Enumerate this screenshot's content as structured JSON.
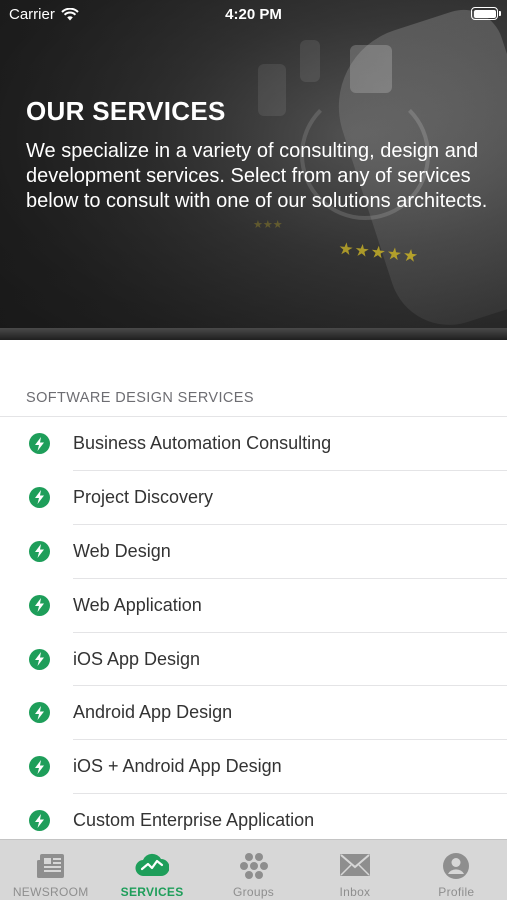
{
  "status_bar": {
    "carrier": "Carrier",
    "time": "4:20 PM"
  },
  "hero": {
    "title": "OUR SERVICES",
    "description": "We specialize in a variety of consulting, design and development services. Select from any of services below to consult with one of our solutions architects."
  },
  "section": {
    "header": "SOFTWARE DESIGN SERVICES",
    "items": [
      {
        "label": "Business Automation Consulting",
        "icon": "bolt-icon"
      },
      {
        "label": "Project Discovery",
        "icon": "bolt-icon"
      },
      {
        "label": "Web Design",
        "icon": "bolt-icon"
      },
      {
        "label": "Web Application",
        "icon": "bolt-icon"
      },
      {
        "label": "iOS App Design",
        "icon": "bolt-icon"
      },
      {
        "label": "Android App Design",
        "icon": "bolt-icon"
      },
      {
        "label": "iOS + Android App Design",
        "icon": "bolt-icon"
      },
      {
        "label": "Custom Enterprise Application",
        "icon": "bolt-icon"
      }
    ]
  },
  "tab_bar": {
    "tabs": [
      {
        "label": "NEWSROOM",
        "icon": "newspaper-icon",
        "active": false
      },
      {
        "label": "SERVICES",
        "icon": "cloud-chart-icon",
        "active": true
      },
      {
        "label": "Groups",
        "icon": "groups-icon",
        "active": false
      },
      {
        "label": "Inbox",
        "icon": "envelope-icon",
        "active": false
      },
      {
        "label": "Profile",
        "icon": "person-icon",
        "active": false
      }
    ]
  },
  "colors": {
    "accent": "#1e9e5a",
    "inactive_tab": "#8e8e8e",
    "tab_bar_bg": "#d7d7d7"
  }
}
